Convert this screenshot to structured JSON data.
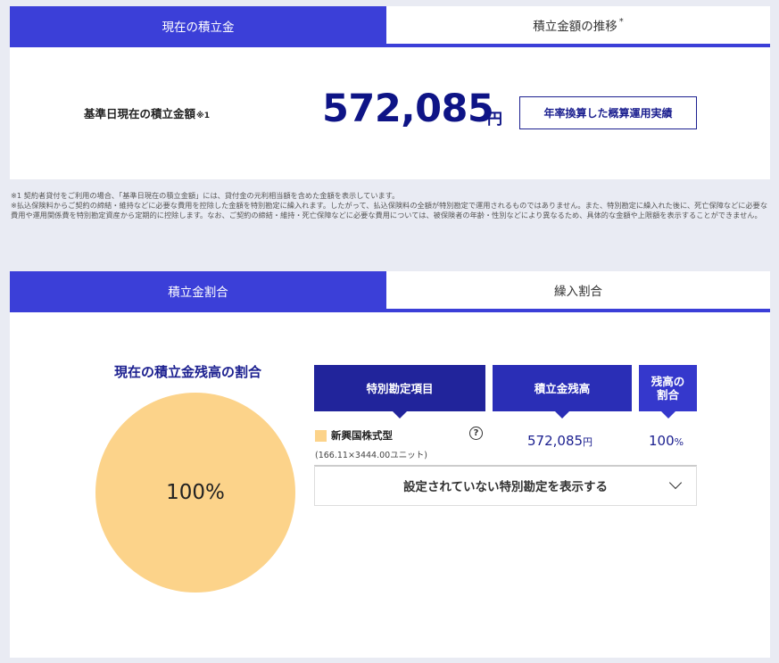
{
  "top_tabs": [
    {
      "label": "現在の積立金"
    },
    {
      "label": "積立金額の推移",
      "mark": "*"
    }
  ],
  "balance": {
    "label": "基準日現在の積立金額",
    "label_note": "※1",
    "amount": "572,085",
    "unit": "円",
    "perf_button": "年率換算した概算運用実績"
  },
  "footnotes": [
    "※1 契約者貸付をご利用の場合、「基準日現在の積立金額」には、貸付金の元利相当額を含めた金額を表示しています。",
    "※払込保険料からご契約の締結・維持などに必要な費用を控除した金額を特別勘定に繰入れます。したがって、払込保険料の全額が特別勘定で運用されるものではありません。また、特別勘定に繰入れた後に、死亡保障などに必要な費用や運用関係費を特別勘定資産から定期的に控除します。なお、ご契約の締結・維持・死亡保障などに必要な費用については、被保険者の年齢・性別などにより異なるため、具体的な金額や上限額を表示することができません。"
  ],
  "mid_tabs": [
    {
      "label": "積立金割合"
    },
    {
      "label": "繰入割合"
    }
  ],
  "allocation": {
    "title": "現在の積立金残高の割合",
    "pie_label": "100%",
    "pie_color": "#fcd38a",
    "headers": {
      "item": "特別勘定項目",
      "balance": "積立金残高",
      "ratio_line1": "残高の",
      "ratio_line2": "割合"
    },
    "rows": [
      {
        "name": "新興国株式型",
        "units": "(166.11×3444.00ユニット)",
        "amount": "572,085",
        "amount_unit": "円",
        "ratio": "100",
        "ratio_unit": "%",
        "icon": "help-circle-icon"
      }
    ],
    "expand_label": "設定されていない特別勘定を表示する"
  },
  "colors": {
    "accent": "#3b3fd8",
    "navy": "#0e1486",
    "fund": "#fcd38a"
  }
}
